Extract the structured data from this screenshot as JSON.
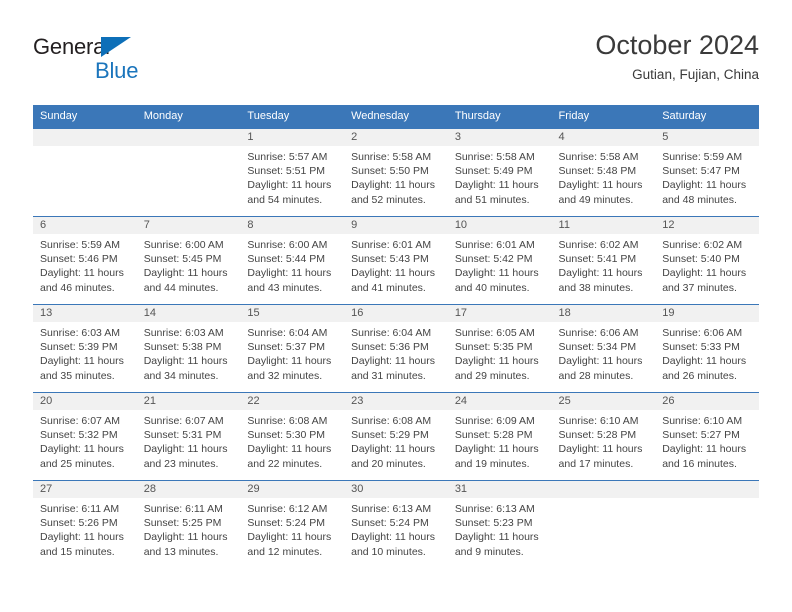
{
  "brand": {
    "word_one": "General",
    "word_two": "Blue",
    "triangle_icon": "triangle-icon",
    "color_dark": "#231f20",
    "color_blue": "#1b75bc"
  },
  "header": {
    "title": "October 2024",
    "location": "Gutian, Fujian, China"
  },
  "theme": {
    "header_blue": "#3b77b8",
    "band_gray": "#f1f1f1",
    "text": "#444444"
  },
  "calendar": {
    "weekday_headers": [
      "Sunday",
      "Monday",
      "Tuesday",
      "Wednesday",
      "Thursday",
      "Friday",
      "Saturday"
    ],
    "weeks": [
      [
        {
          "day": "",
          "sunrise": "",
          "sunset": "",
          "daylight": "",
          "empty": true
        },
        {
          "day": "",
          "sunrise": "",
          "sunset": "",
          "daylight": "",
          "empty": true
        },
        {
          "day": "1",
          "sunrise": "Sunrise: 5:57 AM",
          "sunset": "Sunset: 5:51 PM",
          "daylight": "Daylight: 11 hours and 54 minutes."
        },
        {
          "day": "2",
          "sunrise": "Sunrise: 5:58 AM",
          "sunset": "Sunset: 5:50 PM",
          "daylight": "Daylight: 11 hours and 52 minutes."
        },
        {
          "day": "3",
          "sunrise": "Sunrise: 5:58 AM",
          "sunset": "Sunset: 5:49 PM",
          "daylight": "Daylight: 11 hours and 51 minutes."
        },
        {
          "day": "4",
          "sunrise": "Sunrise: 5:58 AM",
          "sunset": "Sunset: 5:48 PM",
          "daylight": "Daylight: 11 hours and 49 minutes."
        },
        {
          "day": "5",
          "sunrise": "Sunrise: 5:59 AM",
          "sunset": "Sunset: 5:47 PM",
          "daylight": "Daylight: 11 hours and 48 minutes."
        }
      ],
      [
        {
          "day": "6",
          "sunrise": "Sunrise: 5:59 AM",
          "sunset": "Sunset: 5:46 PM",
          "daylight": "Daylight: 11 hours and 46 minutes."
        },
        {
          "day": "7",
          "sunrise": "Sunrise: 6:00 AM",
          "sunset": "Sunset: 5:45 PM",
          "daylight": "Daylight: 11 hours and 44 minutes."
        },
        {
          "day": "8",
          "sunrise": "Sunrise: 6:00 AM",
          "sunset": "Sunset: 5:44 PM",
          "daylight": "Daylight: 11 hours and 43 minutes."
        },
        {
          "day": "9",
          "sunrise": "Sunrise: 6:01 AM",
          "sunset": "Sunset: 5:43 PM",
          "daylight": "Daylight: 11 hours and 41 minutes."
        },
        {
          "day": "10",
          "sunrise": "Sunrise: 6:01 AM",
          "sunset": "Sunset: 5:42 PM",
          "daylight": "Daylight: 11 hours and 40 minutes."
        },
        {
          "day": "11",
          "sunrise": "Sunrise: 6:02 AM",
          "sunset": "Sunset: 5:41 PM",
          "daylight": "Daylight: 11 hours and 38 minutes."
        },
        {
          "day": "12",
          "sunrise": "Sunrise: 6:02 AM",
          "sunset": "Sunset: 5:40 PM",
          "daylight": "Daylight: 11 hours and 37 minutes."
        }
      ],
      [
        {
          "day": "13",
          "sunrise": "Sunrise: 6:03 AM",
          "sunset": "Sunset: 5:39 PM",
          "daylight": "Daylight: 11 hours and 35 minutes."
        },
        {
          "day": "14",
          "sunrise": "Sunrise: 6:03 AM",
          "sunset": "Sunset: 5:38 PM",
          "daylight": "Daylight: 11 hours and 34 minutes."
        },
        {
          "day": "15",
          "sunrise": "Sunrise: 6:04 AM",
          "sunset": "Sunset: 5:37 PM",
          "daylight": "Daylight: 11 hours and 32 minutes."
        },
        {
          "day": "16",
          "sunrise": "Sunrise: 6:04 AM",
          "sunset": "Sunset: 5:36 PM",
          "daylight": "Daylight: 11 hours and 31 minutes."
        },
        {
          "day": "17",
          "sunrise": "Sunrise: 6:05 AM",
          "sunset": "Sunset: 5:35 PM",
          "daylight": "Daylight: 11 hours and 29 minutes."
        },
        {
          "day": "18",
          "sunrise": "Sunrise: 6:06 AM",
          "sunset": "Sunset: 5:34 PM",
          "daylight": "Daylight: 11 hours and 28 minutes."
        },
        {
          "day": "19",
          "sunrise": "Sunrise: 6:06 AM",
          "sunset": "Sunset: 5:33 PM",
          "daylight": "Daylight: 11 hours and 26 minutes."
        }
      ],
      [
        {
          "day": "20",
          "sunrise": "Sunrise: 6:07 AM",
          "sunset": "Sunset: 5:32 PM",
          "daylight": "Daylight: 11 hours and 25 minutes."
        },
        {
          "day": "21",
          "sunrise": "Sunrise: 6:07 AM",
          "sunset": "Sunset: 5:31 PM",
          "daylight": "Daylight: 11 hours and 23 minutes."
        },
        {
          "day": "22",
          "sunrise": "Sunrise: 6:08 AM",
          "sunset": "Sunset: 5:30 PM",
          "daylight": "Daylight: 11 hours and 22 minutes."
        },
        {
          "day": "23",
          "sunrise": "Sunrise: 6:08 AM",
          "sunset": "Sunset: 5:29 PM",
          "daylight": "Daylight: 11 hours and 20 minutes."
        },
        {
          "day": "24",
          "sunrise": "Sunrise: 6:09 AM",
          "sunset": "Sunset: 5:28 PM",
          "daylight": "Daylight: 11 hours and 19 minutes."
        },
        {
          "day": "25",
          "sunrise": "Sunrise: 6:10 AM",
          "sunset": "Sunset: 5:28 PM",
          "daylight": "Daylight: 11 hours and 17 minutes."
        },
        {
          "day": "26",
          "sunrise": "Sunrise: 6:10 AM",
          "sunset": "Sunset: 5:27 PM",
          "daylight": "Daylight: 11 hours and 16 minutes."
        }
      ],
      [
        {
          "day": "27",
          "sunrise": "Sunrise: 6:11 AM",
          "sunset": "Sunset: 5:26 PM",
          "daylight": "Daylight: 11 hours and 15 minutes."
        },
        {
          "day": "28",
          "sunrise": "Sunrise: 6:11 AM",
          "sunset": "Sunset: 5:25 PM",
          "daylight": "Daylight: 11 hours and 13 minutes."
        },
        {
          "day": "29",
          "sunrise": "Sunrise: 6:12 AM",
          "sunset": "Sunset: 5:24 PM",
          "daylight": "Daylight: 11 hours and 12 minutes."
        },
        {
          "day": "30",
          "sunrise": "Sunrise: 6:13 AM",
          "sunset": "Sunset: 5:24 PM",
          "daylight": "Daylight: 11 hours and 10 minutes."
        },
        {
          "day": "31",
          "sunrise": "Sunrise: 6:13 AM",
          "sunset": "Sunset: 5:23 PM",
          "daylight": "Daylight: 11 hours and 9 minutes."
        },
        {
          "day": "",
          "sunrise": "",
          "sunset": "",
          "daylight": "",
          "empty": true
        },
        {
          "day": "",
          "sunrise": "",
          "sunset": "",
          "daylight": "",
          "empty": true
        }
      ]
    ]
  }
}
